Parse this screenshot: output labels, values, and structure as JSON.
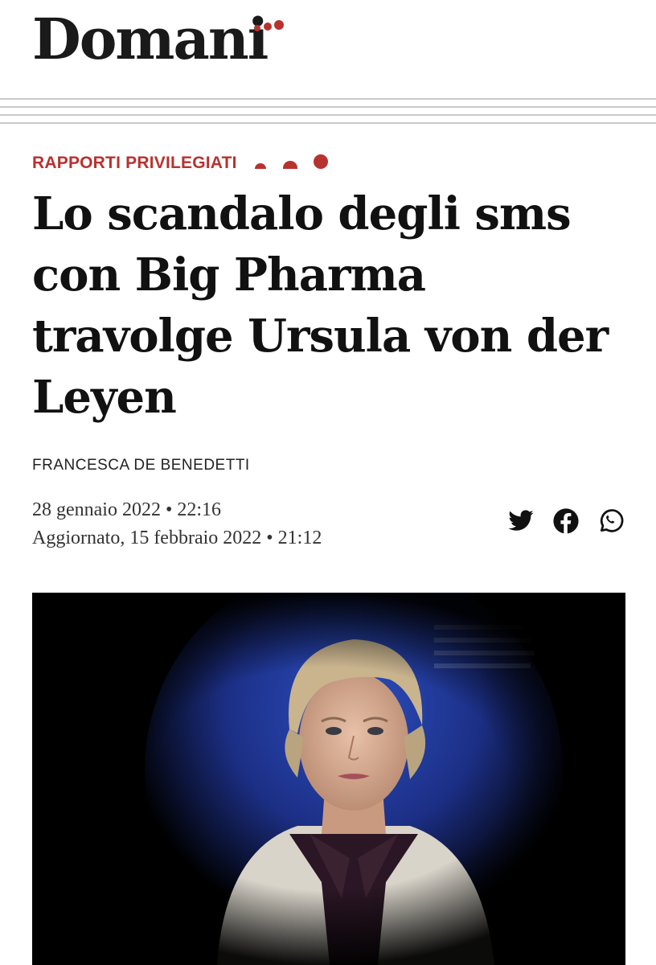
{
  "site": {
    "logo": "Domani"
  },
  "article": {
    "kicker": "RAPPORTI PRIVILEGIATI",
    "headline": "Lo scandalo degli sms con Big Pharma travolge Ursula von der Leyen",
    "author": "FRANCESCA DE BENEDETTI",
    "published": "28 gennaio 2022 • 22:16",
    "updated": "Aggiornato, 15 febbraio 2022 • 21:12"
  },
  "share": [
    {
      "icon": "twitter-icon"
    },
    {
      "icon": "facebook-icon"
    },
    {
      "icon": "whatsapp-icon"
    }
  ],
  "colors": {
    "accent": "#b8322f",
    "text": "#111111",
    "rule": "#c9c9c9"
  }
}
